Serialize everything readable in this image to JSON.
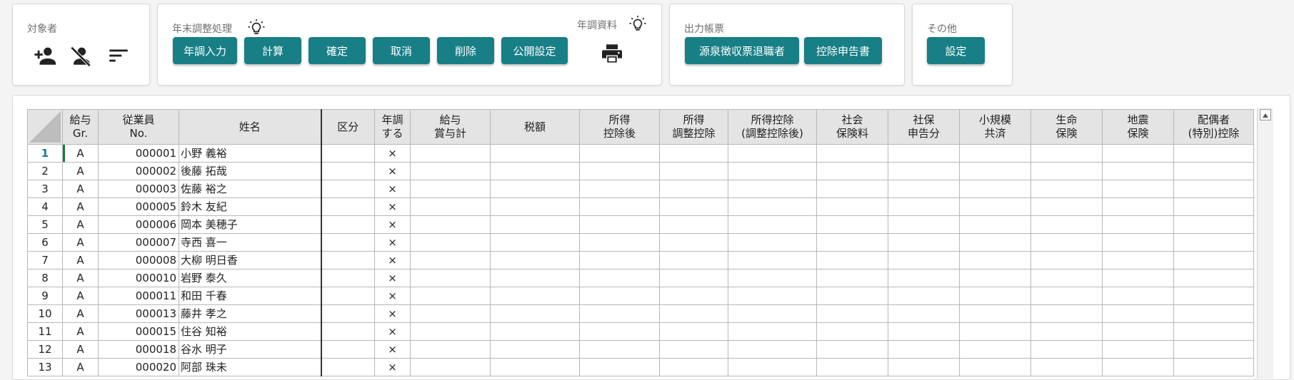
{
  "toolbar": {
    "target": {
      "title": "対象者",
      "icons": [
        "add-person-icon",
        "person-off-icon",
        "sort-lines-icon"
      ]
    },
    "year_end": {
      "title": "年末調整処理",
      "buttons": [
        "年調入力",
        "計算",
        "確定",
        "取消",
        "削除",
        "公開設定"
      ]
    },
    "materials": {
      "title": "年調資料",
      "icons": [
        "print-icon"
      ]
    },
    "output": {
      "title": "出力帳票",
      "buttons": [
        "源泉徴収票退職者",
        "控除申告書"
      ]
    },
    "other": {
      "title": "その他",
      "buttons": [
        "設定"
      ]
    },
    "hint_icon": "lightbulb-icon"
  },
  "grid": {
    "headers": [
      [
        "給与",
        "Gr."
      ],
      [
        "従業員",
        "No."
      ],
      [
        "姓名"
      ],
      [
        "区分"
      ],
      [
        "年調",
        "する"
      ],
      [
        "給与",
        "賞与計"
      ],
      [
        "税額"
      ],
      [
        "所得",
        "控除後"
      ],
      [
        "所得",
        "調整控除"
      ],
      [
        "所得控除",
        "(調整控除後)"
      ],
      [
        "社会",
        "保険料"
      ],
      [
        "社保",
        "申告分"
      ],
      [
        "小規模",
        "共済"
      ],
      [
        "生命",
        "保険"
      ],
      [
        "地震",
        "保険"
      ],
      [
        "配偶者",
        "(特別)控除"
      ]
    ],
    "rows": [
      {
        "n": "1",
        "gr": "A",
        "no": "000001",
        "name": "小野 義裕",
        "kubun": "",
        "nencho": "×"
      },
      {
        "n": "2",
        "gr": "A",
        "no": "000002",
        "name": "後藤 拓哉",
        "kubun": "",
        "nencho": "×"
      },
      {
        "n": "3",
        "gr": "A",
        "no": "000003",
        "name": "佐藤 裕之",
        "kubun": "",
        "nencho": "×"
      },
      {
        "n": "4",
        "gr": "A",
        "no": "000005",
        "name": "鈴木 友紀",
        "kubun": "",
        "nencho": "×"
      },
      {
        "n": "5",
        "gr": "A",
        "no": "000006",
        "name": "岡本 美穂子",
        "kubun": "",
        "nencho": "×"
      },
      {
        "n": "6",
        "gr": "A",
        "no": "000007",
        "name": "寺西 喜一",
        "kubun": "",
        "nencho": "×"
      },
      {
        "n": "7",
        "gr": "A",
        "no": "000008",
        "name": "大柳 明日香",
        "kubun": "",
        "nencho": "×"
      },
      {
        "n": "8",
        "gr": "A",
        "no": "000010",
        "name": "岩野 泰久",
        "kubun": "",
        "nencho": "×"
      },
      {
        "n": "9",
        "gr": "A",
        "no": "000011",
        "name": "和田 千春",
        "kubun": "",
        "nencho": "×"
      },
      {
        "n": "10",
        "gr": "A",
        "no": "000013",
        "name": "藤井 孝之",
        "kubun": "",
        "nencho": "×"
      },
      {
        "n": "11",
        "gr": "A",
        "no": "000015",
        "name": "住谷 知裕",
        "kubun": "",
        "nencho": "×"
      },
      {
        "n": "12",
        "gr": "A",
        "no": "000018",
        "name": "谷水 明子",
        "kubun": "",
        "nencho": "×"
      },
      {
        "n": "13",
        "gr": "A",
        "no": "000020",
        "name": "阿部 珠未",
        "kubun": "",
        "nencho": "×"
      }
    ]
  },
  "colors": {
    "accent": "#177f85",
    "header_bg": "#e4e4e4",
    "active_row": "#1a7a3a"
  }
}
